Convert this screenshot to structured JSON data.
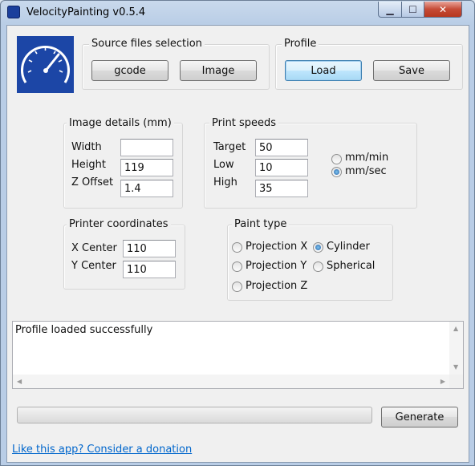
{
  "window": {
    "title": "VelocityPainting v0.5.4"
  },
  "source_files": {
    "label": "Source files selection",
    "gcode_button": "gcode",
    "image_button": "Image"
  },
  "profile": {
    "label": "Profile",
    "load_button": "Load",
    "save_button": "Save"
  },
  "image_details": {
    "label": "Image details (mm)",
    "width_label": "Width",
    "width_value": "",
    "height_label": "Height",
    "height_value": "119",
    "zoffset_label": "Z Offset",
    "zoffset_value": "1.4"
  },
  "print_speeds": {
    "label": "Print speeds",
    "target_label": "Target",
    "target_value": "50",
    "low_label": "Low",
    "low_value": "10",
    "high_label": "High",
    "high_value": "35",
    "unit_mm_min": "mm/min",
    "unit_mm_sec": "mm/sec",
    "selected_unit": "mm/sec"
  },
  "printer_coordinates": {
    "label": "Printer coordinates",
    "xcenter_label": "X Center",
    "xcenter_value": "110",
    "ycenter_label": "Y Center",
    "ycenter_value": "110"
  },
  "paint_type": {
    "label": "Paint type",
    "projection_x": "Projection X",
    "projection_y": "Projection Y",
    "projection_z": "Projection Z",
    "cylinder": "Cylinder",
    "spherical": "Spherical",
    "selected": "Cylinder"
  },
  "log": {
    "text": "Profile loaded successfully"
  },
  "progress": {
    "value": 0
  },
  "generate_button": "Generate",
  "donation_link": "Like this app? Consider a donation",
  "colors": {
    "logo_bg": "#1c46a6",
    "link": "#0066cc",
    "close_button": "#c54b36"
  },
  "icons": {
    "app": "speedometer-icon",
    "logo": "speedometer-icon"
  }
}
